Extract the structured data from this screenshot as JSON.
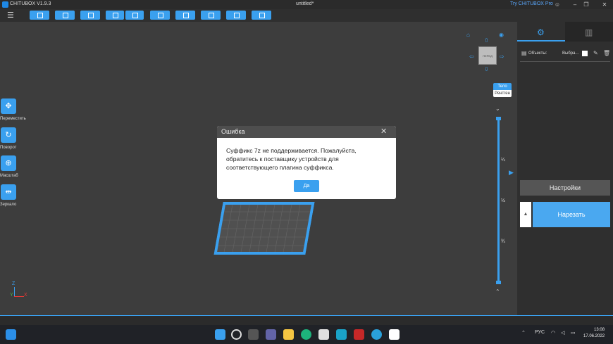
{
  "titlebar": {
    "app_title": "CHITUBOX V1.9.3",
    "document_title": "untitled*",
    "try_pro": "Try CHITUBOX Pro",
    "minimize": "–",
    "maximize": "❐",
    "close": "✕"
  },
  "left_tools": [
    {
      "label": "Переместить",
      "icon": "move-icon"
    },
    {
      "label": "Поворот",
      "icon": "rotate-icon"
    },
    {
      "label": "Масштаб",
      "icon": "scale-icon"
    },
    {
      "label": "Зеркало",
      "icon": "mirror-icon"
    }
  ],
  "navcube": {
    "face_label": "ПЕРЕД"
  },
  "view_mode": {
    "solid": "Тело",
    "xray": "Рентген"
  },
  "layer_slider": {
    "ticks": [
      "¼",
      "½",
      "¾"
    ]
  },
  "axes": {
    "x": "X",
    "y": "Y",
    "z": "Z"
  },
  "sidebar": {
    "objects_label": "Объекты:",
    "select_all_label": "Выбра...",
    "settings_button": "Настройки",
    "slice_button": "Нарезать",
    "slice_up": "▲"
  },
  "dialog": {
    "title": "Ошибка",
    "message": "Суффикс 7z не поддерживается. Пожалуйста, обратитесь к поставщику устройств для соответствующего плагина суффикса.",
    "ok_button": "Да"
  },
  "tray": {
    "language": "РУС",
    "time": "13:08",
    "date": "17.06.2022"
  },
  "colors": {
    "accent": "#3aa0ef",
    "viewport_bg": "#3d3d3d",
    "panel_bg": "#2f2f2f"
  }
}
